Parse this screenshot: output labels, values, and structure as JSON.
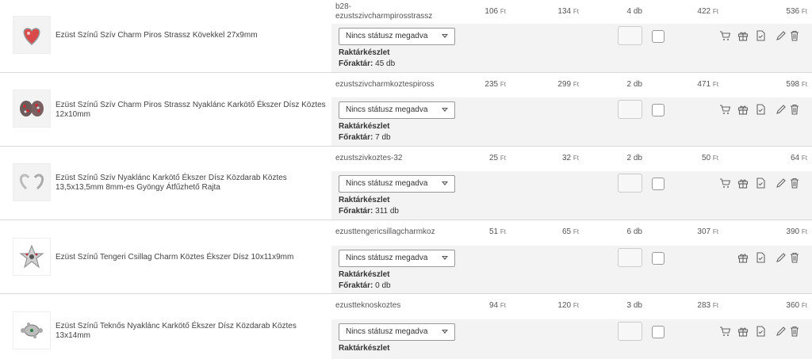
{
  "currency": "Ft",
  "rows": [
    {
      "name": "Ezüst Színű Szív Charm Piros Strassz Kövekkel 27x9mm",
      "sku_line1": "b28-",
      "sku_line2": "ezustszivcharmpirosstrassz",
      "price_net": "106",
      "price_gross": "134",
      "qty": "4 db",
      "total_net": "422",
      "total_gross": "536",
      "status": "Nincs státusz megadva",
      "stock_label": "Raktárkészlet",
      "warehouse_label": "Főraktár:",
      "warehouse_value": "45 db",
      "has_cart": true
    },
    {
      "name": "Ezüst Színű Szív Charm Piros Strassz Nyaklánc Karkötő Ékszer Dísz Köztes 12x10mm",
      "sku_line1": "ezustszivcharmkoztespiross",
      "price_net": "235",
      "price_gross": "299",
      "qty": "2 db",
      "total_net": "471",
      "total_gross": "598",
      "status": "Nincs státusz megadva",
      "stock_label": "Raktárkészlet",
      "warehouse_label": "Főraktár:",
      "warehouse_value": "7 db",
      "has_cart": true
    },
    {
      "name": "Ezüst Színű Szív Nyaklánc Karkötő Ékszer Dísz Közdarab Köztes 13,5x13,5mm 8mm-es Gyöngy Átfűzhető Rajta",
      "sku_line1": "ezustszivkoztes-32",
      "price_net": "25",
      "price_gross": "32",
      "qty": "2 db",
      "total_net": "50",
      "total_gross": "64",
      "status": "Nincs státusz megadva",
      "stock_label": "Raktárkészlet",
      "warehouse_label": "Főraktár:",
      "warehouse_value": "311 db",
      "has_cart": true
    },
    {
      "name": "Ezüst Színű Tengeri Csillag Charm Köztes Ékszer Dísz 10x11x9mm",
      "sku_line1": "ezusttengericsillagcharmkoz",
      "price_net": "51",
      "price_gross": "65",
      "qty": "6 db",
      "total_net": "307",
      "total_gross": "390",
      "status": "Nincs státusz megadva",
      "stock_label": "Raktárkészlet",
      "warehouse_label": "Főraktár:",
      "warehouse_value": "0 db",
      "has_cart": false
    },
    {
      "name": "Ezüst Színű Teknős Nyaklánc Karkötő Ékszer Dísz Közdarab Köztes 13x14mm",
      "sku_line1": "ezustteknoskoztes",
      "price_net": "94",
      "price_gross": "120",
      "qty": "3 db",
      "total_net": "283",
      "total_gross": "360",
      "status": "Nincs státusz megadva",
      "stock_label": "Raktárkészlet",
      "warehouse_label": "",
      "warehouse_value": "",
      "has_cart": true
    }
  ],
  "icons": {
    "cart": "cart-icon",
    "gift": "gift-icon",
    "doc": "document-check-icon",
    "edit": "pencil-icon",
    "trash": "trash-icon"
  },
  "colors": {
    "row_grey": "#f3f3f3",
    "border": "#d9d9d9",
    "text": "#333333"
  }
}
